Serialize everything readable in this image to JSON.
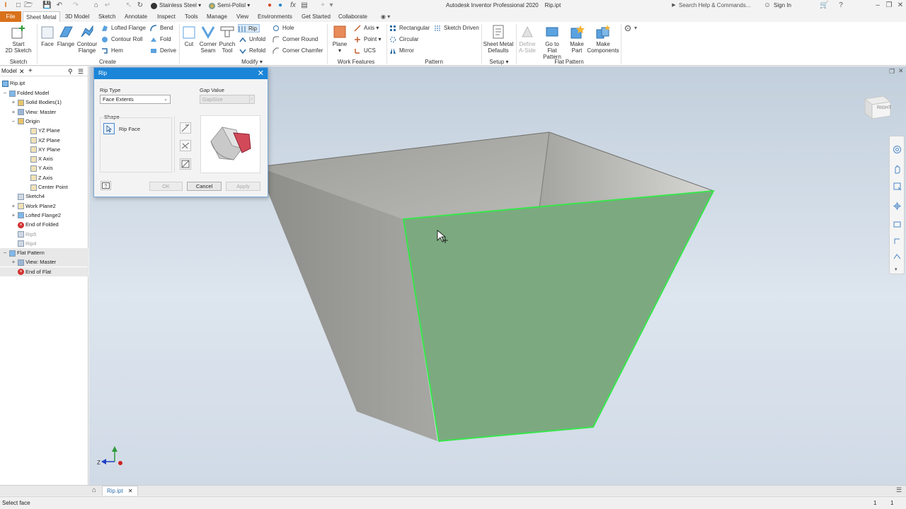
{
  "app": {
    "title": "Autodesk Inventor Professional 2020",
    "document": "Rip.ipt",
    "material": "Stainless Steel",
    "appearance": "Semi-Polisl",
    "search_placeholder": "Search Help & Commands...",
    "sign_in": "Sign In",
    "accent": "#1b85d8",
    "file_tab_color": "#d9711b"
  },
  "tabs": [
    "File",
    "Sheet Metal",
    "3D Model",
    "Sketch",
    "Annotate",
    "Inspect",
    "Tools",
    "Manage",
    "View",
    "Environments",
    "Get Started",
    "Collaborate"
  ],
  "active_tab": "Sheet Metal",
  "ribbon": {
    "sketch": {
      "start_line1": "Start",
      "start_line2": "2D Sketch",
      "panel": "Sketch"
    },
    "create": {
      "face": "Face",
      "flange": "Flange",
      "contour_line1": "Contour",
      "contour_line2": "Flange",
      "lofted_flange": "Lofted Flange",
      "contour_roll": "Contour Roll",
      "hem": "Hem",
      "bend": "Bend",
      "fold": "Fold",
      "derive": "Derive",
      "panel": "Create"
    },
    "modify": {
      "cut": "Cut",
      "corner_line1": "Corner",
      "corner_line2": "Seam",
      "punch_line1": "Punch",
      "punch_line2": "Tool",
      "rip": "Rip",
      "unfold": "Unfold",
      "refold": "Refold",
      "hole": "Hole",
      "corner_round": "Corner Round",
      "corner_chamfer": "Corner Chamfer",
      "panel": "Modify"
    },
    "work_features": {
      "plane": "Plane",
      "axis": "Axis",
      "point": "Point",
      "ucs": "UCS",
      "panel": "Work Features"
    },
    "pattern": {
      "rectangular": "Rectangular",
      "circular": "Circular",
      "mirror": "Mirror",
      "sketch_driven": "Sketch Driven",
      "panel": "Pattern"
    },
    "setup": {
      "defaults_line1": "Sheet Metal",
      "defaults_line2": "Defaults",
      "panel": "Setup"
    },
    "flat_pattern": {
      "define_line1": "Define",
      "define_line2": "A-Side",
      "goto_line1": "Go to",
      "goto_line2": "Flat Pattern",
      "make_part_line1": "Make",
      "make_part_line2": "Part",
      "make_comp_line1": "Make",
      "make_comp_line2": "Components",
      "panel": "Flat Pattern"
    }
  },
  "browser": {
    "tab": "Model",
    "root": "Rip.ipt",
    "items": [
      {
        "label": "Folded Model",
        "icon": "folded-model",
        "level": 0,
        "expander": "−"
      },
      {
        "label": "Solid Bodies(1)",
        "icon": "folder",
        "level": 1,
        "expander": "+"
      },
      {
        "label": "View: Master",
        "icon": "view",
        "level": 1,
        "expander": "+"
      },
      {
        "label": "Origin",
        "icon": "folder",
        "level": 1,
        "expander": "−"
      },
      {
        "label": "YZ Plane",
        "icon": "plane",
        "level": 2,
        "expander": ""
      },
      {
        "label": "XZ Plane",
        "icon": "plane",
        "level": 2,
        "expander": ""
      },
      {
        "label": "XY Plane",
        "icon": "plane",
        "level": 2,
        "expander": ""
      },
      {
        "label": "X Axis",
        "icon": "axis",
        "level": 2,
        "expander": ""
      },
      {
        "label": "Y Axis",
        "icon": "axis",
        "level": 2,
        "expander": ""
      },
      {
        "label": "Z Axis",
        "icon": "axis",
        "level": 2,
        "expander": ""
      },
      {
        "label": "Center Point",
        "icon": "point",
        "level": 2,
        "expander": ""
      },
      {
        "label": "Sketch4",
        "icon": "sketch",
        "level": 1,
        "expander": ""
      },
      {
        "label": "Work Plane2",
        "icon": "plane",
        "level": 1,
        "expander": "+"
      },
      {
        "label": "Lofted Flange2",
        "icon": "flange",
        "level": 1,
        "expander": "+"
      },
      {
        "label": "End of Folded",
        "icon": "error",
        "level": 1,
        "expander": ""
      },
      {
        "label": "Rip5",
        "icon": "rip",
        "level": 1,
        "expander": "",
        "disabled": true
      },
      {
        "label": "Rip4",
        "icon": "rip",
        "level": 1,
        "expander": "",
        "disabled": true
      },
      {
        "label": "Flat Pattern",
        "icon": "flat",
        "level": 0,
        "expander": "−",
        "selected": true
      },
      {
        "label": "View: Master",
        "icon": "view",
        "level": 1,
        "expander": "+",
        "selected": true
      },
      {
        "label": "End of Flat",
        "icon": "error",
        "level": 1,
        "expander": "",
        "selected": true
      }
    ]
  },
  "dialog": {
    "title": "Rip",
    "rip_type_label": "Rip Type",
    "rip_type_value": "Face Extents",
    "gap_label": "Gap Value",
    "gap_value": "GapSize",
    "shape_label": "Shape",
    "rip_face": "Rip Face",
    "ok": "OK",
    "cancel": "Cancel",
    "apply": "Apply"
  },
  "viewcube": {
    "face": "RIGHT"
  },
  "doc_tabs": [
    "Rip.ipt"
  ],
  "status": {
    "message": "Select face",
    "count1": "1",
    "count2": "1"
  }
}
